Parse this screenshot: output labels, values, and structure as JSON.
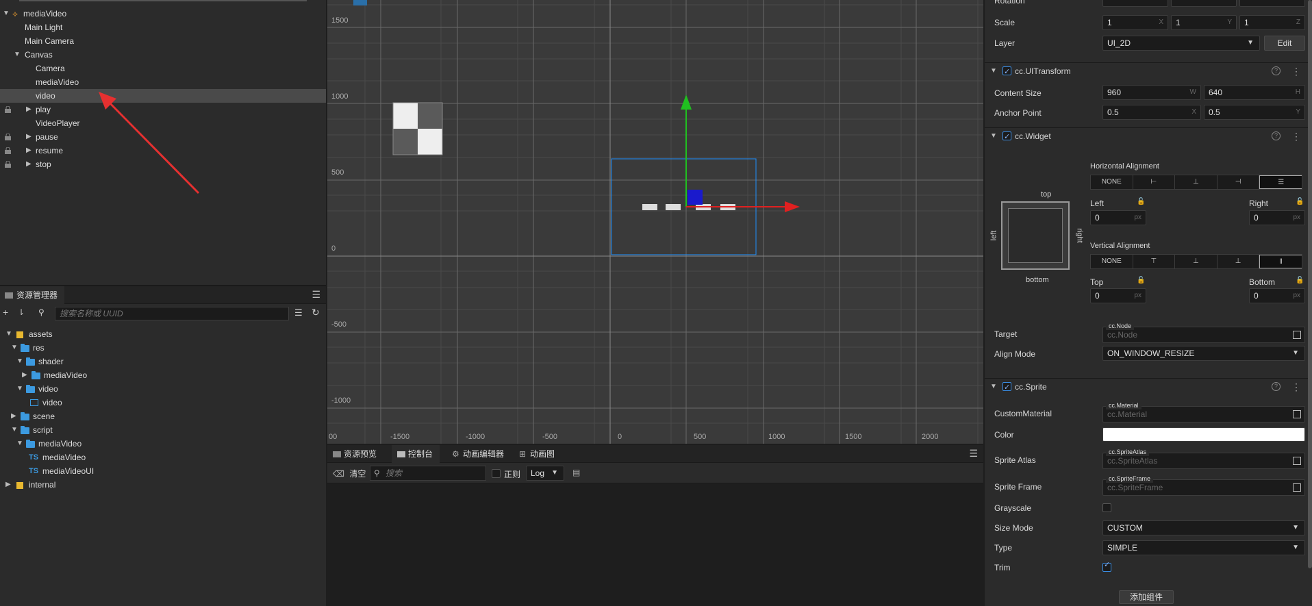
{
  "hierarchy": {
    "root": "mediaVideo",
    "items": [
      {
        "label": "Main Light"
      },
      {
        "label": "Main Camera"
      },
      {
        "label": "Canvas"
      },
      {
        "label": "Camera"
      },
      {
        "label": "mediaVideo"
      },
      {
        "label": "video"
      },
      {
        "label": "play"
      },
      {
        "label": "VideoPlayer"
      },
      {
        "label": "pause"
      },
      {
        "label": "resume"
      },
      {
        "label": "stop"
      }
    ]
  },
  "assets_panel": {
    "title": "资源管理器",
    "search_placeholder": "搜索名称或 UUID",
    "items": [
      {
        "label": "assets"
      },
      {
        "label": "res"
      },
      {
        "label": "shader"
      },
      {
        "label": "mediaVideo"
      },
      {
        "label": "video"
      },
      {
        "label": "video"
      },
      {
        "label": "scene"
      },
      {
        "label": "script"
      },
      {
        "label": "mediaVideo"
      },
      {
        "label": "mediaVideo"
      },
      {
        "label": "mediaVideoUI"
      },
      {
        "label": "internal"
      }
    ],
    "ts_badge": "TS"
  },
  "scene": {
    "y_labels": [
      "1500",
      "1000",
      "500",
      "0",
      "-500",
      "-1000"
    ],
    "x_labels": [
      "00",
      "-1500",
      "-1000",
      "-500",
      "0",
      "500",
      "1000",
      "1500",
      "2000"
    ]
  },
  "console": {
    "tabs": [
      "资源预览",
      "控制台",
      "动画编辑器",
      "动画图"
    ],
    "clear": "清空",
    "search_placeholder": "搜索",
    "regex": "正则",
    "level": "Log"
  },
  "inspector": {
    "rotation_label": "Rotation",
    "scale_label": "Scale",
    "scale": {
      "x": "1",
      "y": "1",
      "z": "1"
    },
    "axis_x": "X",
    "axis_y": "Y",
    "axis_z": "Z",
    "layer_label": "Layer",
    "layer_value": "UI_2D",
    "edit": "Edit",
    "uitransform": {
      "title": "cc.UITransform",
      "content_size_label": "Content Size",
      "width": "960",
      "w_axis": "W",
      "height": "640",
      "h_axis": "H",
      "anchor_label": "Anchor Point",
      "anchor_x": "0.5",
      "anchor_y": "0.5"
    },
    "widget": {
      "title": "cc.Widget",
      "h_align_label": "Horizontal Alignment",
      "v_align_label": "Vertical Alignment",
      "none": "NONE",
      "top": "top",
      "bottom": "bottom",
      "left": "left",
      "right": "right",
      "left_label": "Left",
      "right_label": "Right",
      "top_label": "Top",
      "bottom_label": "Bottom",
      "left_value": "0",
      "right_value": "0",
      "top_value": "0",
      "bottom_value": "0",
      "unit": "px",
      "target_label": "Target",
      "target_tag": "cc.Node",
      "target_placeholder": "cc.Node",
      "align_mode_label": "Align Mode",
      "align_mode_value": "ON_WINDOW_RESIZE"
    },
    "sprite": {
      "title": "cc.Sprite",
      "custom_material_label": "CustomMaterial",
      "material_tag": "cc.Material",
      "material_placeholder": "cc.Material",
      "color_label": "Color",
      "color_value": "#ffffff",
      "atlas_label": "Sprite Atlas",
      "atlas_tag": "cc.SpriteAtlas",
      "atlas_placeholder": "cc.SpriteAtlas",
      "frame_label": "Sprite Frame",
      "frame_tag": "cc.SpriteFrame",
      "frame_placeholder": "cc.SpriteFrame",
      "grayscale_label": "Grayscale",
      "size_mode_label": "Size Mode",
      "size_mode_value": "CUSTOM",
      "type_label": "Type",
      "type_value": "SIMPLE",
      "trim_label": "Trim"
    },
    "add_component": "添加组件"
  }
}
